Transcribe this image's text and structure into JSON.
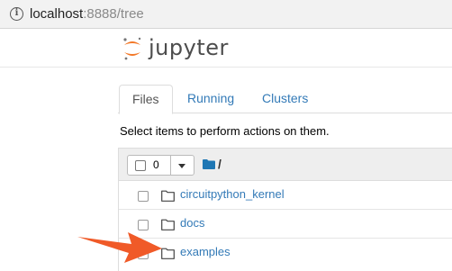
{
  "browser": {
    "url_host": "localhost",
    "url_rest": ":8888/tree"
  },
  "header": {
    "logo_text": "jupyter"
  },
  "tabs": [
    {
      "label": "Files",
      "active": true
    },
    {
      "label": "Running",
      "active": false
    },
    {
      "label": "Clusters",
      "active": false
    }
  ],
  "hint_text": "Select items to perform actions on them.",
  "list_header": {
    "selected_count": "0",
    "breadcrumb": "/"
  },
  "files": [
    {
      "name": "circuitpython_kernel",
      "type": "folder"
    },
    {
      "name": "docs",
      "type": "folder"
    },
    {
      "name": "examples",
      "type": "folder"
    }
  ],
  "colors": {
    "link": "#337ab7",
    "jupyter_orange": "#f37726",
    "annotation_arrow": "#f05a28"
  }
}
